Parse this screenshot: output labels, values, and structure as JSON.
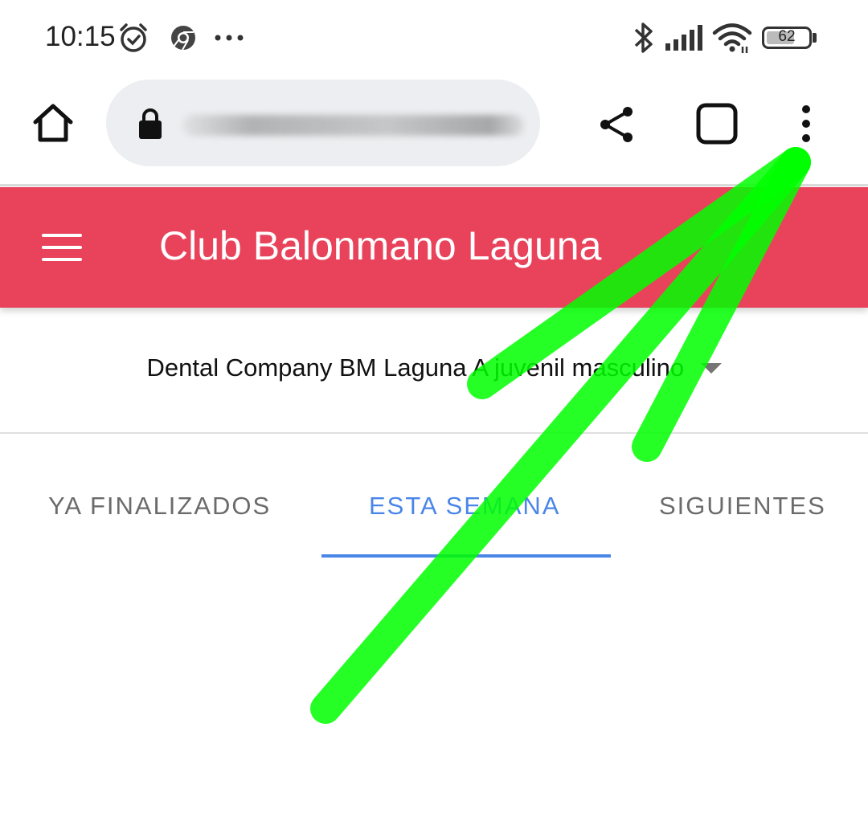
{
  "status_bar": {
    "time": "10:15",
    "battery": "62",
    "icons": [
      "alarm-icon",
      "chrome-icon",
      "more-notifications-icon",
      "bluetooth-icon",
      "signal-icon",
      "wifi-icon",
      "battery-icon"
    ]
  },
  "browser": {
    "url_obscured": true,
    "icons": [
      "home-icon",
      "lock-icon",
      "share-icon",
      "tabs-icon",
      "more-vert-icon"
    ]
  },
  "header": {
    "title": "Club Balonmano Laguna",
    "background_color": "#e9435c"
  },
  "team_select": {
    "selected": "Dental Company BM Laguna A juvenil masculino"
  },
  "tabs": [
    {
      "label": "YA FINALIZADOS",
      "active": false
    },
    {
      "label": "ESTA SEMANA",
      "active": true
    },
    {
      "label": "SIGUIENTES",
      "active": false
    }
  ],
  "colors": {
    "accent": "#4a86e8",
    "annotation_arrow": "#00ff00"
  }
}
